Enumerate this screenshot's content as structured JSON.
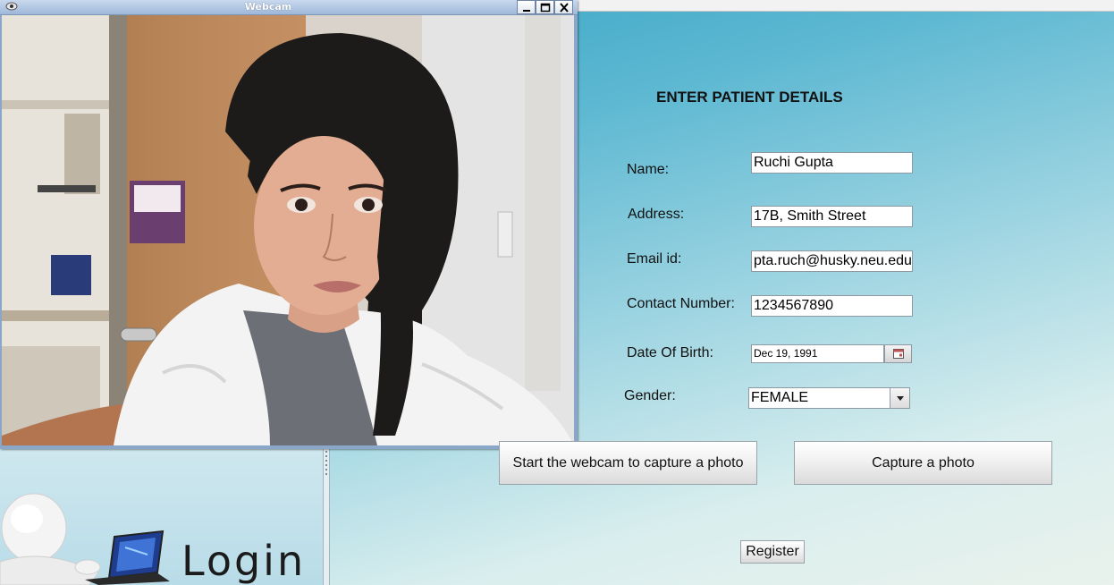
{
  "webcam_window": {
    "title": "Webcam"
  },
  "login_panel": {
    "logo_text": "Login"
  },
  "form": {
    "title": "ENTER PATIENT DETAILS",
    "name_label": "Name:",
    "name_value": "Ruchi Gupta",
    "address_label": "Address:",
    "address_value": "17B, Smith Street",
    "email_label": "Email id:",
    "email_value": "pta.ruch@husky.neu.edu",
    "contact_label": "Contact Number:",
    "contact_value": "1234567890",
    "dob_label": "Date Of Birth:",
    "dob_value": "Dec 19, 1991",
    "gender_label": "Gender:",
    "gender_value": "FEMALE"
  },
  "buttons": {
    "start_webcam": "Start the webcam to capture a photo",
    "capture": "Capture a photo",
    "register": "Register"
  },
  "icons": {
    "app": "webcam-app-icon",
    "minimize": "minimize-icon",
    "maximize": "maximize-icon",
    "close": "close-icon",
    "calendar": "calendar-icon",
    "dropdown": "chevron-down-icon"
  }
}
